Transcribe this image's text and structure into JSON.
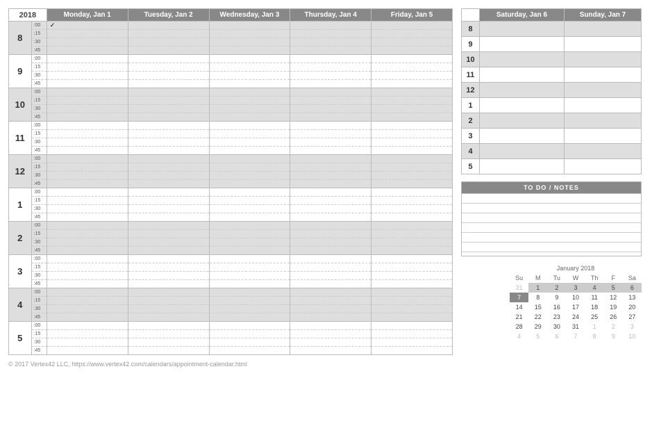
{
  "year": "2018",
  "weekdays": [
    {
      "label": "Monday, Jan 1"
    },
    {
      "label": "Tuesday, Jan 2"
    },
    {
      "label": "Wednesday, Jan 3"
    },
    {
      "label": "Thursday, Jan 4"
    },
    {
      "label": "Friday, Jan 5"
    }
  ],
  "weekend": [
    {
      "label": "Saturday, Jan 6"
    },
    {
      "label": "Sunday, Jan 7"
    }
  ],
  "hours": [
    "8",
    "9",
    "10",
    "11",
    "12",
    "1",
    "2",
    "3",
    "4",
    "5"
  ],
  "minutes": [
    ":00",
    ":15",
    ":30",
    ":45"
  ],
  "check_mark": "✓",
  "weekend_hours": [
    "8",
    "9",
    "10",
    "11",
    "12",
    "1",
    "2",
    "3",
    "4",
    "5"
  ],
  "todo_header": "TO DO  /  NOTES",
  "mini_calendar": {
    "title": "January 2018",
    "dow": [
      "Su",
      "M",
      "Tu",
      "W",
      "Th",
      "F",
      "Sa"
    ],
    "weeks": [
      [
        {
          "d": "31",
          "other": true
        },
        {
          "d": "1",
          "hl": "light"
        },
        {
          "d": "2",
          "hl": "light"
        },
        {
          "d": "3",
          "hl": "light"
        },
        {
          "d": "4",
          "hl": "light"
        },
        {
          "d": "5",
          "hl": "light"
        },
        {
          "d": "6",
          "hl": "light"
        }
      ],
      [
        {
          "d": "7",
          "hl": "dark"
        },
        {
          "d": "8"
        },
        {
          "d": "9"
        },
        {
          "d": "10"
        },
        {
          "d": "11"
        },
        {
          "d": "12"
        },
        {
          "d": "13"
        }
      ],
      [
        {
          "d": "14"
        },
        {
          "d": "15"
        },
        {
          "d": "16"
        },
        {
          "d": "17"
        },
        {
          "d": "18"
        },
        {
          "d": "19"
        },
        {
          "d": "20"
        }
      ],
      [
        {
          "d": "21"
        },
        {
          "d": "22"
        },
        {
          "d": "23"
        },
        {
          "d": "24"
        },
        {
          "d": "25"
        },
        {
          "d": "26"
        },
        {
          "d": "27"
        }
      ],
      [
        {
          "d": "28"
        },
        {
          "d": "29"
        },
        {
          "d": "30"
        },
        {
          "d": "31"
        },
        {
          "d": "1",
          "other": true
        },
        {
          "d": "2",
          "other": true
        },
        {
          "d": "3",
          "other": true
        }
      ],
      [
        {
          "d": "4",
          "other": true
        },
        {
          "d": "5",
          "other": true
        },
        {
          "d": "6",
          "other": true
        },
        {
          "d": "7",
          "other": true
        },
        {
          "d": "8",
          "other": true
        },
        {
          "d": "9",
          "other": true
        },
        {
          "d": "10",
          "other": true
        }
      ]
    ]
  },
  "footer": "© 2017 Vertex42 LLC, https://www.vertex42.com/calendars/appointment-calendar.html"
}
